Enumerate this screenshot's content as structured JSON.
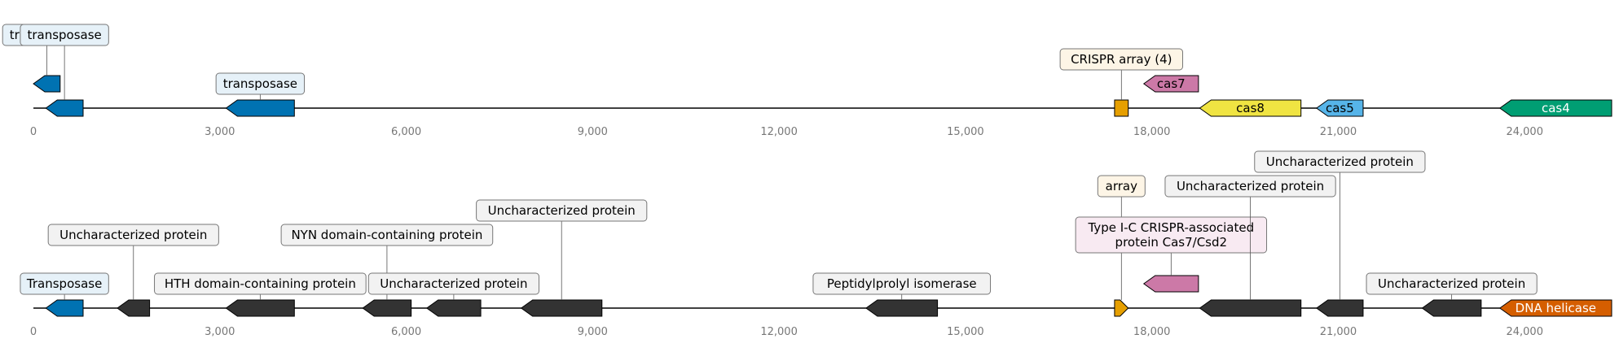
{
  "colors": {
    "transposase": "#0072b2",
    "crispr_array": "#e69f00",
    "cas7": "#cc79a7",
    "cas8": "#f0e442",
    "cas5": "#56b4e9",
    "cas4": "#009e73",
    "uncharacterized": "#333333",
    "helicase": "#d55e00",
    "backbone": "#000000",
    "tick_label": "#777777",
    "label_box_border": "#777777"
  },
  "axis": {
    "xlim": [
      0,
      25400
    ],
    "ticks": [
      {
        "value": 0,
        "label": "0"
      },
      {
        "value": 3000,
        "label": "3,000"
      },
      {
        "value": 6000,
        "label": "6,000"
      },
      {
        "value": 9000,
        "label": "9,000"
      },
      {
        "value": 12000,
        "label": "12,000"
      },
      {
        "value": 15000,
        "label": "15,000"
      },
      {
        "value": 18000,
        "label": "18,000"
      },
      {
        "value": 21000,
        "label": "21,000"
      },
      {
        "value": 24000,
        "label": "24,000"
      }
    ]
  },
  "tracks": [
    {
      "features": [
        {
          "start": 0,
          "end": 430,
          "strand": -1,
          "level": 1,
          "color": "#0072b2",
          "label": "transposase",
          "label_level": 2,
          "label_fill": "#e6f1f8",
          "label_text_color": "#000000"
        },
        {
          "start": 200,
          "end": 800,
          "strand": -1,
          "level": 0,
          "color": "#0072b2",
          "label": "transposase",
          "label_level": 3,
          "label_fill": "#e6f1f8",
          "label_text_color": "#000000"
        },
        {
          "start": 3100,
          "end": 4200,
          "strand": -1,
          "level": 0,
          "color": "#0072b2",
          "label": "transposase",
          "label_level": 1,
          "label_fill": "#e6f1f8",
          "label_text_color": "#000000"
        },
        {
          "start": 17400,
          "end": 17620,
          "strand": 0,
          "level": 0,
          "color": "#e69f00",
          "label": "CRISPR array (4)",
          "label_level": 2,
          "label_fill": "#fdf5e6",
          "label_text_color": "#000000"
        },
        {
          "start": 17870,
          "end": 18750,
          "strand": -1,
          "level": 1,
          "color": "#cc79a7",
          "label": "cas7",
          "label_level": 0,
          "label_fill": "none",
          "label_text_color": "#000000"
        },
        {
          "start": 18770,
          "end": 20400,
          "strand": -1,
          "level": 0,
          "color": "#f0e442",
          "label": "cas8",
          "label_level": 0,
          "label_fill": "none",
          "label_text_color": "#000000"
        },
        {
          "start": 20650,
          "end": 21400,
          "strand": -1,
          "level": 0,
          "color": "#56b4e9",
          "label": "cas5",
          "label_level": 0,
          "label_fill": "none",
          "label_text_color": "#000000"
        },
        {
          "start": 23600,
          "end": 25400,
          "strand": -1,
          "level": 0,
          "color": "#009e73",
          "label": "cas4",
          "label_level": 0,
          "label_fill": "none",
          "label_text_color": "#ffffff"
        }
      ]
    },
    {
      "features": [
        {
          "start": 200,
          "end": 800,
          "strand": -1,
          "level": 0,
          "color": "#0072b2",
          "label": "Transposase",
          "label_level": 1,
          "label_fill": "#e6f1f8",
          "label_text_color": "#000000"
        },
        {
          "start": 1350,
          "end": 1870,
          "strand": -1,
          "level": 0,
          "color": "#333333",
          "label": "Uncharacterized protein",
          "label_level": 3,
          "label_fill": "#f2f2f2",
          "label_text_color": "#000000"
        },
        {
          "start": 3100,
          "end": 4200,
          "strand": -1,
          "level": 0,
          "color": "#333333",
          "label": "HTH domain-containing protein",
          "label_level": 1,
          "label_fill": "#f2f2f2",
          "label_text_color": "#000000"
        },
        {
          "start": 5300,
          "end": 6080,
          "strand": -1,
          "level": 0,
          "color": "#333333",
          "label": "NYN domain-containing protein",
          "label_level": 3,
          "label_fill": "#f2f2f2",
          "label_text_color": "#000000"
        },
        {
          "start": 6330,
          "end": 7200,
          "strand": -1,
          "level": 0,
          "color": "#333333",
          "label": "Uncharacterized protein",
          "label_level": 1,
          "label_fill": "#f2f2f2",
          "label_text_color": "#000000"
        },
        {
          "start": 7850,
          "end": 9150,
          "strand": -1,
          "level": 0,
          "color": "#333333",
          "label": "Uncharacterized protein",
          "label_level": 4,
          "label_fill": "#f2f2f2",
          "label_text_color": "#000000"
        },
        {
          "start": 13400,
          "end": 14550,
          "strand": -1,
          "level": 0,
          "color": "#333333",
          "label": "Peptidylprolyl isomerase",
          "label_level": 1,
          "label_fill": "#f2f2f2",
          "label_text_color": "#000000"
        },
        {
          "start": 17400,
          "end": 17620,
          "strand": 1,
          "level": 0,
          "color": "#e69f00",
          "label": "array",
          "label_level": 5,
          "label_fill": "#fdf5e6",
          "label_text_color": "#000000"
        },
        {
          "start": 17870,
          "end": 18750,
          "strand": -1,
          "level": 1,
          "color": "#cc79a7",
          "label": "Type I-C CRISPR-associated\nprotein Cas7/Csd2",
          "label_level": 2,
          "label_fill": "#f8eaf2",
          "label_text_color": "#000000"
        },
        {
          "start": 18770,
          "end": 20400,
          "strand": -1,
          "level": 0,
          "color": "#333333",
          "label": "Uncharacterized protein",
          "label_level": 5,
          "label_fill": "#f2f2f2",
          "label_text_color": "#000000"
        },
        {
          "start": 20650,
          "end": 21400,
          "strand": -1,
          "level": 0,
          "color": "#333333",
          "label": "Uncharacterized protein",
          "label_level": 6,
          "label_fill": "#f2f2f2",
          "label_text_color": "#000000"
        },
        {
          "start": 22350,
          "end": 23300,
          "strand": -1,
          "level": 0,
          "color": "#333333",
          "label": "Uncharacterized protein",
          "label_level": 1,
          "label_fill": "#f2f2f2",
          "label_text_color": "#000000"
        },
        {
          "start": 23600,
          "end": 25400,
          "strand": -1,
          "level": 0,
          "color": "#d55e00",
          "label": "DNA helicase",
          "label_level": 0,
          "label_fill": "none",
          "label_text_color": "#ffffff"
        }
      ]
    }
  ]
}
